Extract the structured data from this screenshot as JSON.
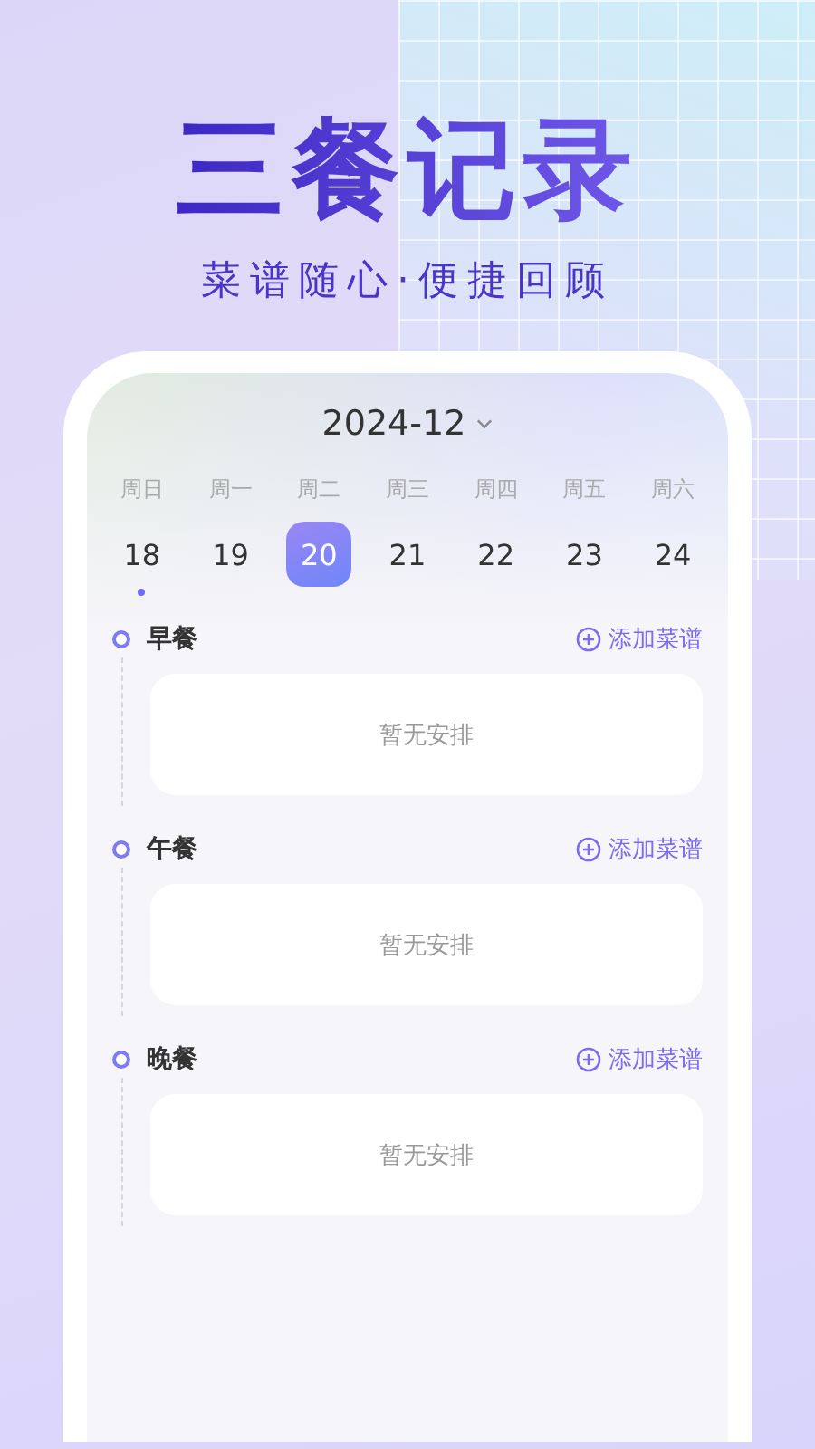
{
  "headline": "三餐记录",
  "subtitle": "菜谱随心·便捷回顾",
  "calendar": {
    "month": "2024-12",
    "weekdays": [
      "周日",
      "周一",
      "周二",
      "周三",
      "周四",
      "周五",
      "周六"
    ],
    "days": [
      {
        "date": "18",
        "selected": false,
        "marked": true
      },
      {
        "date": "19",
        "selected": false,
        "marked": false
      },
      {
        "date": "20",
        "selected": true,
        "marked": false
      },
      {
        "date": "21",
        "selected": false,
        "marked": false
      },
      {
        "date": "22",
        "selected": false,
        "marked": false
      },
      {
        "date": "23",
        "selected": false,
        "marked": false
      },
      {
        "date": "24",
        "selected": false,
        "marked": false
      }
    ]
  },
  "meals": [
    {
      "name": "早餐",
      "action": "添加菜谱",
      "empty_text": "暂无安排"
    },
    {
      "name": "午餐",
      "action": "添加菜谱",
      "empty_text": "暂无安排"
    },
    {
      "name": "晚餐",
      "action": "添加菜谱",
      "empty_text": "暂无安排"
    }
  ]
}
